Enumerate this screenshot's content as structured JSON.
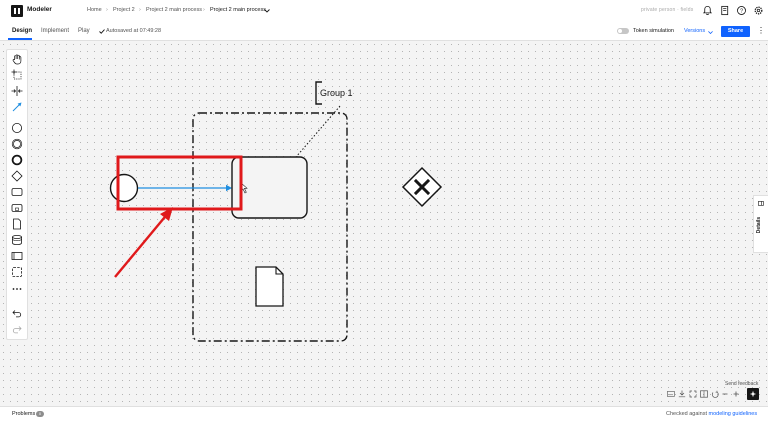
{
  "header": {
    "app_name": "Modeler",
    "breadcrumbs": [
      "Home",
      "Project 2",
      "Project 2 main process"
    ],
    "current": "Project 2 main process",
    "separator": "›",
    "user": "private person · fields"
  },
  "subbar": {
    "tabs": [
      "Design",
      "Implement",
      "Play"
    ],
    "autosave": "Autosaved at 07:49:28",
    "token_simulation": "Token simulation",
    "versions": "Versions",
    "share": "Share"
  },
  "diagram": {
    "group_label": "Group 1",
    "highlight_color": "#e0191b",
    "connector_color": "#1f8ee0"
  },
  "side_panel": {
    "details": "Details"
  },
  "footer": {
    "problems": "Problems",
    "problems_count": "0",
    "checked_prefix": "Checked against ",
    "checked_link": "modeling guidelines",
    "send_feedback": "Send feedback"
  },
  "icons": {
    "palette": [
      "hand-icon",
      "lasso-icon",
      "space-tool-icon",
      "global-connect-icon",
      "start-event-icon",
      "intermediate-event-icon",
      "end-event-icon",
      "gateway-icon",
      "task-icon",
      "subprocess-icon",
      "data-object-icon",
      "data-store-icon",
      "pool-icon",
      "group-icon",
      "more-icon",
      "undo-icon",
      "redo-icon"
    ]
  }
}
